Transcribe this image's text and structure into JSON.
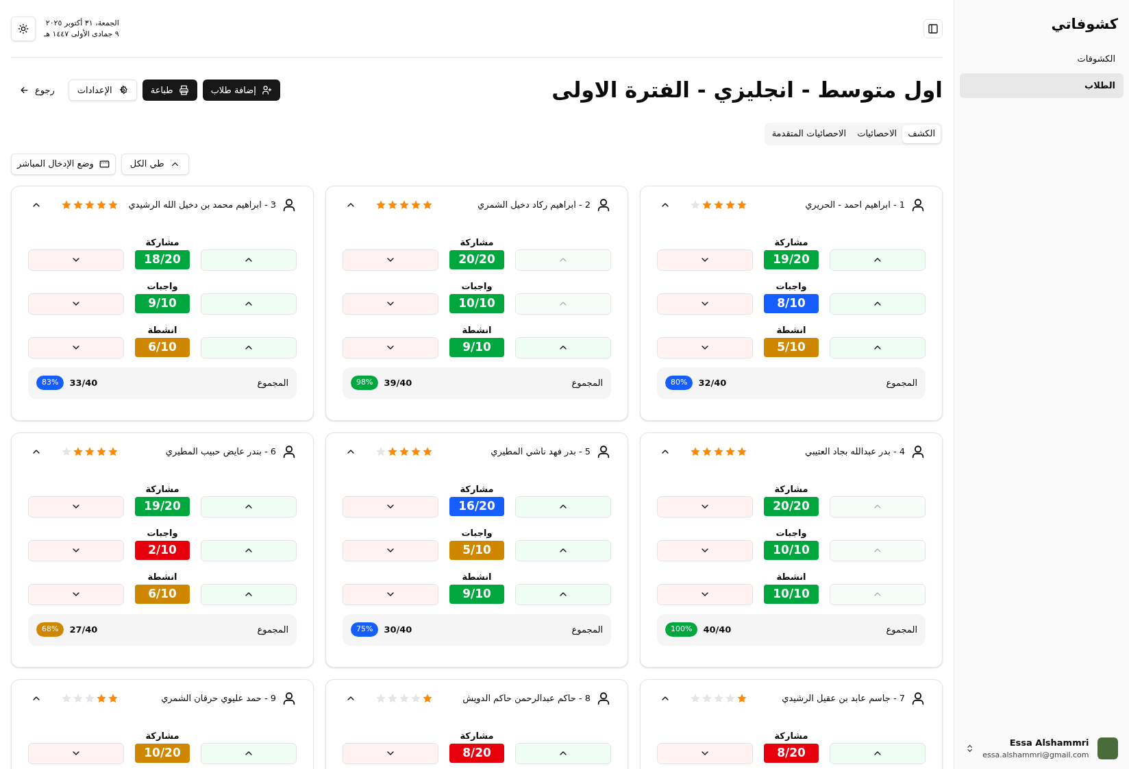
{
  "sidebar": {
    "title": "كشوفاتي",
    "items": [
      {
        "label": "الكشوفات",
        "selected": false
      },
      {
        "label": "الطلاب",
        "selected": true
      }
    ],
    "user": {
      "name": "Essa Alshammri",
      "email": "essa.alshammri@gmail.com"
    }
  },
  "header": {
    "date_gregorian": "الجمعة، ٣١ أكتوبر ٢٠٢٥",
    "date_hijri": "٩ جمادى الأولى ١٤٤٧ هـ"
  },
  "page": {
    "title": "اول متوسط - انجليزي - الفترة الاولى",
    "actions": [
      {
        "kind": "add",
        "label": "إضافة طلاب"
      },
      {
        "kind": "print",
        "label": "طباعة"
      },
      {
        "kind": "settings",
        "label": "الإعدادات"
      },
      {
        "kind": "back",
        "label": "رجوع"
      }
    ],
    "tabs": [
      {
        "label": "الكشف",
        "selected": true
      },
      {
        "label": "الاحصائيات",
        "selected": false
      },
      {
        "label": "الاحصائيات المتقدمة",
        "selected": false
      }
    ],
    "toolbar": [
      {
        "kind": "collapse",
        "label": "طي الكل"
      },
      {
        "kind": "direct",
        "label": "وضع الإدخال المباشر"
      }
    ]
  },
  "students": [
    {
      "name": "1 - ابراهيم احمد - الحريري",
      "stars": 4,
      "metrics": [
        {
          "label": "مشاركة",
          "score": "19/20",
          "color": "#00a63e",
          "up_disabled": false
        },
        {
          "label": "واجبات",
          "score": "8/10",
          "color": "#155dfc",
          "up_disabled": false
        },
        {
          "label": "انشطة",
          "score": "5/10",
          "color": "#d08700",
          "up_disabled": false
        }
      ],
      "total_label": "المجموع",
      "total": "32/40",
      "percent": {
        "label": "80%",
        "color": "#155dfc"
      }
    },
    {
      "name": "2 - ابراهيم ركاد دخيل الشمري",
      "stars": 5,
      "metrics": [
        {
          "label": "مشاركة",
          "score": "20/20",
          "color": "#00a63e",
          "up_disabled": true
        },
        {
          "label": "واجبات",
          "score": "10/10",
          "color": "#00a63e",
          "up_disabled": true
        },
        {
          "label": "انشطة",
          "score": "9/10",
          "color": "#00a63e",
          "up_disabled": false
        }
      ],
      "total_label": "المجموع",
      "total": "39/40",
      "percent": {
        "label": "98%",
        "color": "#00a63e"
      }
    },
    {
      "name": "3 - ابراهيم محمد بن دخيل الله الرشيدي",
      "stars": 5,
      "metrics": [
        {
          "label": "مشاركة",
          "score": "18/20",
          "color": "#00a63e",
          "up_disabled": false
        },
        {
          "label": "واجبات",
          "score": "9/10",
          "color": "#00a63e",
          "up_disabled": false
        },
        {
          "label": "انشطة",
          "score": "6/10",
          "color": "#d08700",
          "up_disabled": false
        }
      ],
      "total_label": "المجموع",
      "total": "33/40",
      "percent": {
        "label": "83%",
        "color": "#155dfc"
      }
    },
    {
      "name": "4 - بدر عبدالله بجاد العتيبي",
      "stars": 5,
      "metrics": [
        {
          "label": "مشاركة",
          "score": "20/20",
          "color": "#00a63e",
          "up_disabled": true
        },
        {
          "label": "واجبات",
          "score": "10/10",
          "color": "#00a63e",
          "up_disabled": true
        },
        {
          "label": "انشطة",
          "score": "10/10",
          "color": "#00a63e",
          "up_disabled": true
        }
      ],
      "total_label": "المجموع",
      "total": "40/40",
      "percent": {
        "label": "100%",
        "color": "#00a63e"
      }
    },
    {
      "name": "5 - بدر فهد ناشي المطيري",
      "stars": 4,
      "metrics": [
        {
          "label": "مشاركة",
          "score": "16/20",
          "color": "#155dfc",
          "up_disabled": false
        },
        {
          "label": "واجبات",
          "score": "5/10",
          "color": "#d08700",
          "up_disabled": false
        },
        {
          "label": "انشطة",
          "score": "9/10",
          "color": "#00a63e",
          "up_disabled": false
        }
      ],
      "total_label": "المجموع",
      "total": "30/40",
      "percent": {
        "label": "75%",
        "color": "#155dfc"
      }
    },
    {
      "name": "6 - بندر عايض حبيب المطيري",
      "stars": 4,
      "metrics": [
        {
          "label": "مشاركة",
          "score": "19/20",
          "color": "#00a63e",
          "up_disabled": false
        },
        {
          "label": "واجبات",
          "score": "2/10",
          "color": "#e7000b",
          "up_disabled": false
        },
        {
          "label": "انشطة",
          "score": "6/10",
          "color": "#d08700",
          "up_disabled": false
        }
      ],
      "total_label": "المجموع",
      "total": "27/40",
      "percent": {
        "label": "68%",
        "color": "#d08700"
      }
    },
    {
      "name": "7 - جاسم عابد بن عقيل الرشيدي",
      "stars": 1,
      "metrics": [
        {
          "label": "مشاركة",
          "score": "8/20",
          "color": "#e7000b",
          "up_disabled": false
        }
      ]
    },
    {
      "name": "8 - حاكم عبدالرحمن حاكم الدويش",
      "stars": 1,
      "metrics": [
        {
          "label": "مشاركة",
          "score": "8/20",
          "color": "#e7000b",
          "up_disabled": false
        }
      ]
    },
    {
      "name": "9 - حمد عليوي حرقان الشمري",
      "stars": 2,
      "metrics": [
        {
          "label": "مشاركة",
          "score": "10/20",
          "color": "#d08700",
          "up_disabled": false
        }
      ]
    }
  ]
}
